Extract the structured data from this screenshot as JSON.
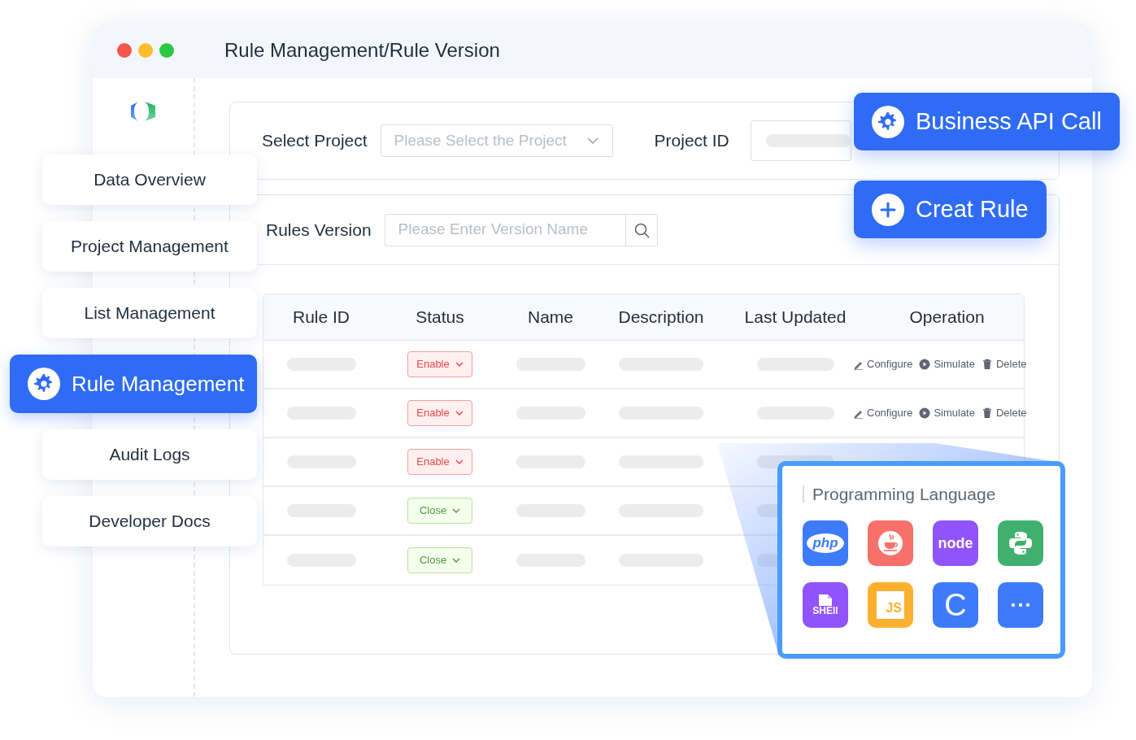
{
  "window": {
    "title": "Rule Management/Rule Version"
  },
  "sidebar": {
    "items": [
      {
        "label": "Data Overview",
        "selected": false
      },
      {
        "label": "Project Management",
        "selected": false
      },
      {
        "label": "List Management",
        "selected": false
      },
      {
        "label": "Rule Management",
        "selected": true
      },
      {
        "label": "Audit Logs",
        "selected": false
      },
      {
        "label": "Developer Docs",
        "selected": false
      }
    ]
  },
  "filters": {
    "project": {
      "label": "Select Project",
      "placeholder": "Please Select the Project"
    },
    "project_id": {
      "label": "Project ID"
    },
    "version": {
      "label": "Rules Version",
      "placeholder": "Please Enter Version Name"
    }
  },
  "floating_buttons": [
    {
      "label": "Business API Call",
      "kind": "settings"
    },
    {
      "label": "Creat Rule",
      "kind": "add"
    }
  ],
  "table": {
    "columns": [
      "Rule ID",
      "Status",
      "Name",
      "Description",
      "Last Updated",
      "Operation"
    ],
    "rows": [
      {
        "status": "Enable",
        "kind": "enable",
        "operations": [
          {
            "label": "Configure",
            "kind": "edit"
          },
          {
            "label": "Simulate",
            "kind": "play"
          },
          {
            "label": "Delete",
            "kind": "delete"
          }
        ]
      },
      {
        "status": "Enable",
        "kind": "enable",
        "operations": [
          {
            "label": "Configure",
            "kind": "edit"
          },
          {
            "label": "Simulate",
            "kind": "play"
          },
          {
            "label": "Delete",
            "kind": "delete"
          }
        ]
      },
      {
        "status": "Enable",
        "kind": "enable"
      },
      {
        "status": "Close",
        "kind": "close"
      },
      {
        "status": "Close",
        "kind": "close"
      }
    ]
  },
  "languages_panel": {
    "title": "Programming Language",
    "languages": [
      {
        "kind": "php",
        "label": "php",
        "color": "#3d7bfb"
      },
      {
        "kind": "java",
        "color": "#f8706a"
      },
      {
        "kind": "node",
        "label": "node",
        "color": "#9153fb"
      },
      {
        "kind": "python",
        "color": "#40b06e"
      },
      {
        "kind": "shell",
        "label": "SHEll",
        "color": "#9153fb"
      },
      {
        "kind": "js",
        "label": "JS",
        "color": "#fdb02f"
      },
      {
        "kind": "c",
        "label": "C",
        "color": "#3d7bfb"
      },
      {
        "kind": "more",
        "color": "#3d7bfb"
      }
    ]
  }
}
